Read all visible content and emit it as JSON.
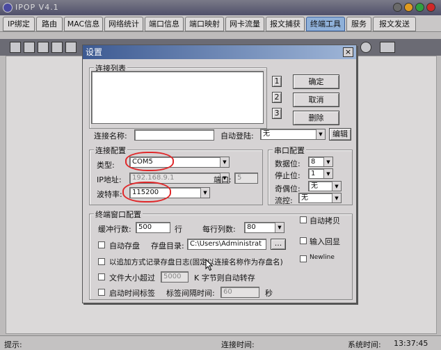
{
  "app": {
    "title": "IPOP V4.1"
  },
  "tabs": [
    "IP绑定",
    "路由",
    "MAC信息",
    "网络统计",
    "端口信息",
    "端口映射",
    "网卡流量",
    "报文捕获",
    "终端工具",
    "服务",
    "报文发送"
  ],
  "active_tab": 8,
  "status": {
    "hint_label": "提示:",
    "conn_time_label": "连接时间:",
    "sys_time_label": "系统时间:",
    "sys_time": "13:37:45"
  },
  "dialog": {
    "title": "设置",
    "close": "×",
    "conn_list_label": "连接列表",
    "num_buttons": [
      "1",
      "2",
      "3"
    ],
    "ok": "确定",
    "cancel": "取消",
    "delete": "删除",
    "conn_name_label": "连接名称:",
    "conn_name_value": "",
    "auto_login_label": "自动登陆:",
    "auto_login_value": "无",
    "edit": "编辑",
    "conn_cfg_label": "连接配置",
    "type_label": "类型:",
    "type_value": "COM5",
    "ip_label": "IP地址:",
    "ip_value": "192.168.9.1",
    "port_label": "端口:",
    "port_value": "5",
    "baud_label": "波特率:",
    "baud_value": "115200",
    "serial_cfg_label": "串口配置",
    "databits_label": "数据位:",
    "databits_value": "8",
    "stopbits_label": "停止位:",
    "stopbits_value": "1",
    "parity_label": "奇偶位:",
    "parity_value": "无",
    "flow_label": "流控:",
    "flow_value": "无",
    "term_cfg_label": "终端窗口配置",
    "buffer_label": "缓冲行数:",
    "buffer_value": "500",
    "row_unit": "行",
    "cols_label": "每行列数:",
    "cols_value": "80",
    "auto_copy": "自动拷贝",
    "auto_save": "自动存盘",
    "save_dir_label": "存盘目录:",
    "save_dir_value": "C:\\Users\\Administrat",
    "browse": "...",
    "echo": "输入回显",
    "append_log": "以追加方式记录存盘日志(固定以连接名称作为存盘名)",
    "newline": "Newline",
    "size_over": "文件大小超过",
    "size_value": "5000",
    "size_suffix": "K 字节则自动转存",
    "timestamp": "启动时间标签",
    "interval_label": "标签间隔时间:",
    "interval_value": "60",
    "sec": "秒"
  }
}
